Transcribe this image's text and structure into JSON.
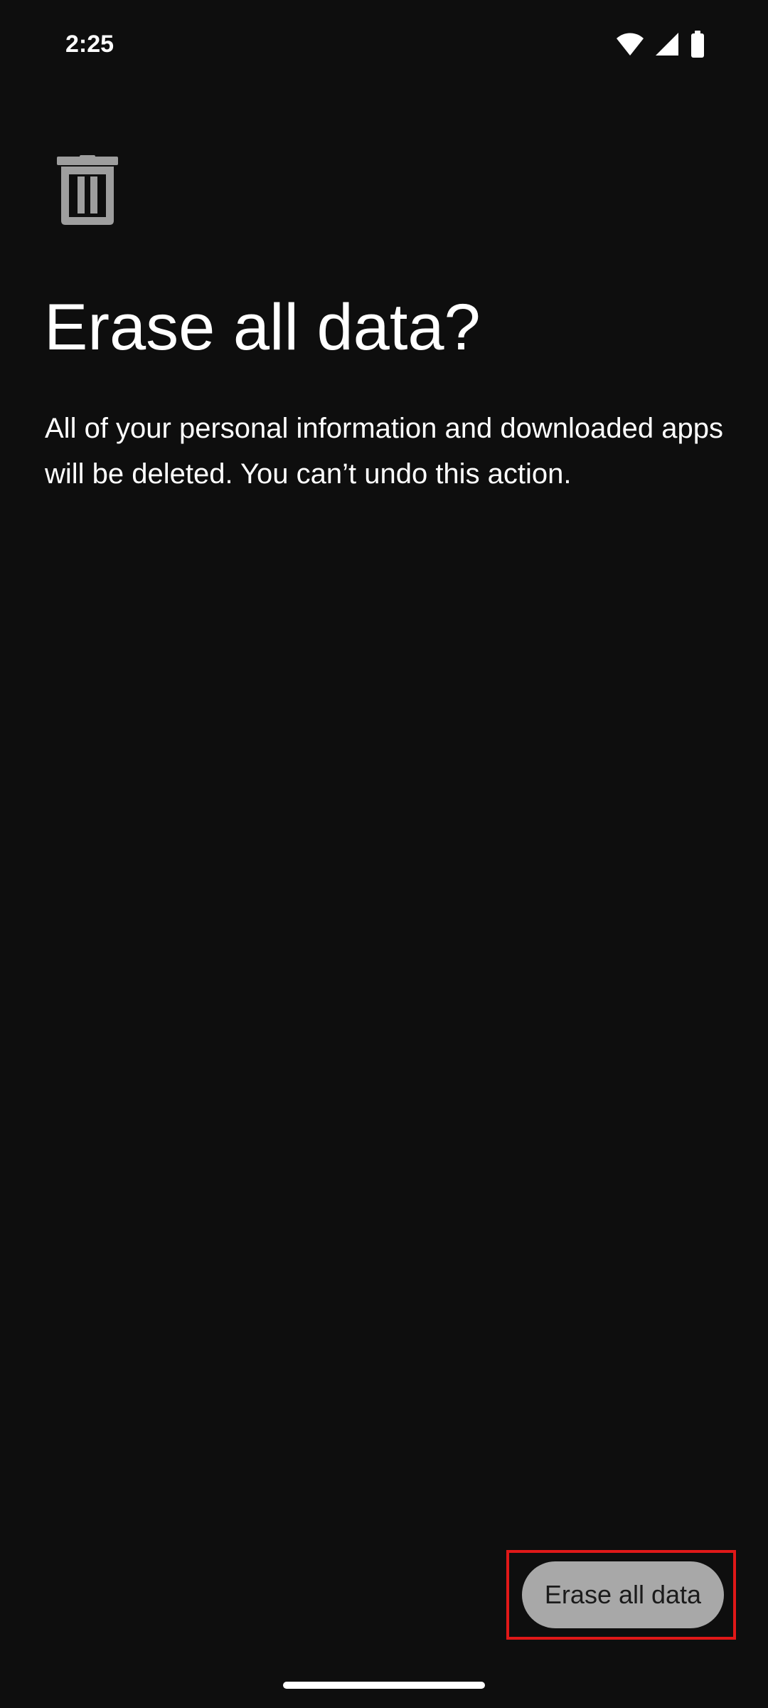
{
  "status_bar": {
    "time": "2:25",
    "icons": [
      "wifi-icon",
      "cellular-signal-icon",
      "battery-icon"
    ]
  },
  "dialog": {
    "icon": "trash-icon",
    "title": "Erase all data?",
    "description": "All of your personal information and downloaded apps will be deleted. You can’t undo this action."
  },
  "actions": {
    "erase_label": "Erase all data",
    "highlighted": true
  },
  "colors": {
    "background": "#0e0e0e",
    "text": "#ffffff",
    "icon": "#9e9e9e",
    "button_fill": "#a8a8a8",
    "button_text": "#1b1b1b",
    "highlight": "#e01818"
  }
}
